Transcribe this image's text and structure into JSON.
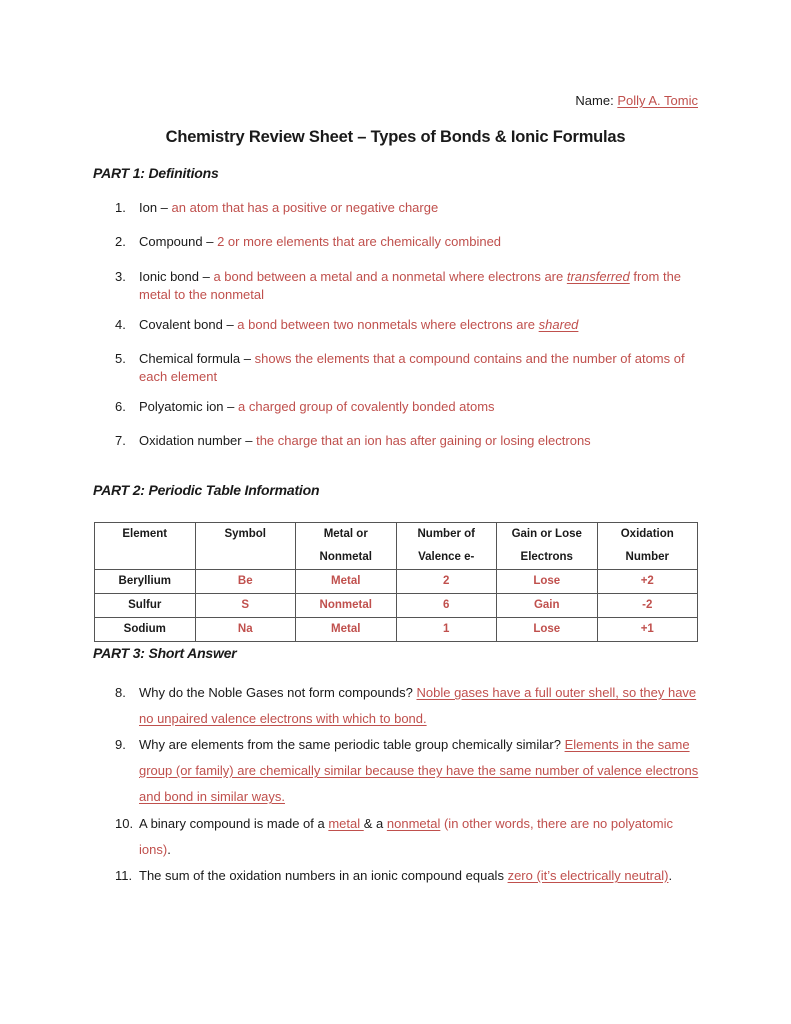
{
  "header": {
    "name_label": "Name: ",
    "name_value": "Polly A. Tomic"
  },
  "title": "Chemistry Review Sheet – Types of Bonds & Ionic Formulas",
  "part1": {
    "heading": "PART 1: Definitions",
    "items": [
      {
        "num": "1.",
        "term": "Ion – ",
        "answer": "an atom that has a positive or negative charge"
      },
      {
        "num": "2.",
        "term": "Compound – ",
        "answer": "2 or more elements that are chemically combined"
      },
      {
        "num": "3.",
        "term": "Ionic bond – ",
        "answer_pre": "a bond between a metal and a nonmetal where electrons are ",
        "answer_emph": "transferred",
        "answer_post": " from the metal to the nonmetal"
      },
      {
        "num": "4.",
        "term": "Covalent bond – ",
        "answer_pre": "a bond between two nonmetals where electrons are ",
        "answer_emph": "shared"
      },
      {
        "num": "5.",
        "term": "Chemical formula – ",
        "answer": "shows the elements that a compound contains and the number of atoms of each element"
      },
      {
        "num": "6.",
        "term": "Polyatomic ion – ",
        "answer": "a charged group of covalently bonded atoms"
      },
      {
        "num": "7.",
        "term": "Oxidation number – ",
        "answer": "the charge that an ion has after gaining or losing electrons"
      }
    ]
  },
  "part2": {
    "heading": "PART 2: Periodic Table Information",
    "columns": [
      {
        "line1": "Element",
        "line2": ""
      },
      {
        "line1": "Symbol",
        "line2": ""
      },
      {
        "line1": "Metal or",
        "line2": "Nonmetal"
      },
      {
        "line1": "Number of",
        "line2": "Valence e-"
      },
      {
        "line1": "Gain or Lose",
        "line2": "Electrons"
      },
      {
        "line1": "Oxidation",
        "line2": "Number"
      }
    ],
    "rows": [
      {
        "element": "Beryllium",
        "symbol": "Be",
        "type": "Metal",
        "valence": "2",
        "gain_lose": "Lose",
        "oxidation": "+2"
      },
      {
        "element": "Sulfur",
        "symbol": "S",
        "type": "Nonmetal",
        "valence": "6",
        "gain_lose": "Gain",
        "oxidation": "-2"
      },
      {
        "element": "Sodium",
        "symbol": "Na",
        "type": "Metal",
        "valence": "1",
        "gain_lose": "Lose",
        "oxidation": "+1"
      }
    ]
  },
  "part3": {
    "heading": "PART 3: Short Answer",
    "items": [
      {
        "num": "8.",
        "question": "Why do the Noble Gases not form compounds? ",
        "answer": "Noble gases have a full outer shell, so they have no unpaired valence electrons with which to bond."
      },
      {
        "num": "9.",
        "question": "Why are elements from the same periodic table group chemically similar? ",
        "answer": "Elements in the same group (or family) are chemically similar because they have the same number of valence electrons and bond in similar ways."
      },
      {
        "num": "10.",
        "q_pre": "A binary compound is made of a ",
        "blank1": "metal ",
        "q_mid": "& a ",
        "blank2": "nonmetal",
        "q_post_red": " (in other words, there are no polyatomic ions)",
        "q_end": "."
      },
      {
        "num": "11.",
        "question": "The sum of the oxidation numbers in an ionic compound equals ",
        "answer": "zero (it’s electrically neutral)",
        "q_end": "."
      }
    ]
  },
  "colors": {
    "answer_red": "#c0504d",
    "text": "#1a1a1a",
    "table_border": "#555555"
  }
}
